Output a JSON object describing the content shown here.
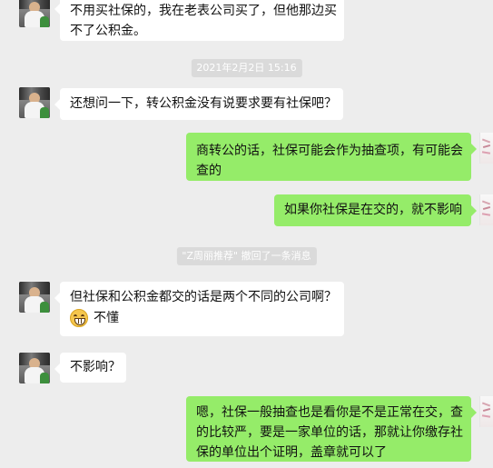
{
  "chat": {
    "messages": [
      {
        "type": "incoming",
        "lines": [
          "不用买社保的，我在老表公司买了，但他那边买",
          "不了公积金。"
        ]
      },
      {
        "type": "timestamp",
        "text": "2021年2月2日 15:16"
      },
      {
        "type": "incoming",
        "lines": [
          "还想问一下，转公积金没有说要求要有社保吧？"
        ]
      },
      {
        "type": "outgoing",
        "lines": [
          "商转公的话，社保可能会作为抽查项，有可能会",
          "查的"
        ]
      },
      {
        "type": "outgoing",
        "lines": [
          "如果你社保是在交的，就不影响"
        ]
      },
      {
        "type": "system",
        "text": "\"Z周丽推荐\" 撤回了一条消息"
      },
      {
        "type": "incoming",
        "lines": [
          "但社保和公积金都交的话是两个不同的公司啊？"
        ],
        "emoji": "grinning-face",
        "emoji_text": "不懂"
      },
      {
        "type": "incoming",
        "lines": [
          "不影响？"
        ]
      },
      {
        "type": "outgoing",
        "lines": [
          "嗯，社保一般抽查也是看你是不是正常在交，查",
          "的比较严，要是一家单位的话，那就让你缴存社",
          "保的单位出个证明，盖章就可以了"
        ]
      }
    ]
  },
  "colors": {
    "background": "#ededed",
    "incoming_bubble": "#ffffff",
    "outgoing_bubble": "#95ec69",
    "system_pill": "#dadada"
  }
}
